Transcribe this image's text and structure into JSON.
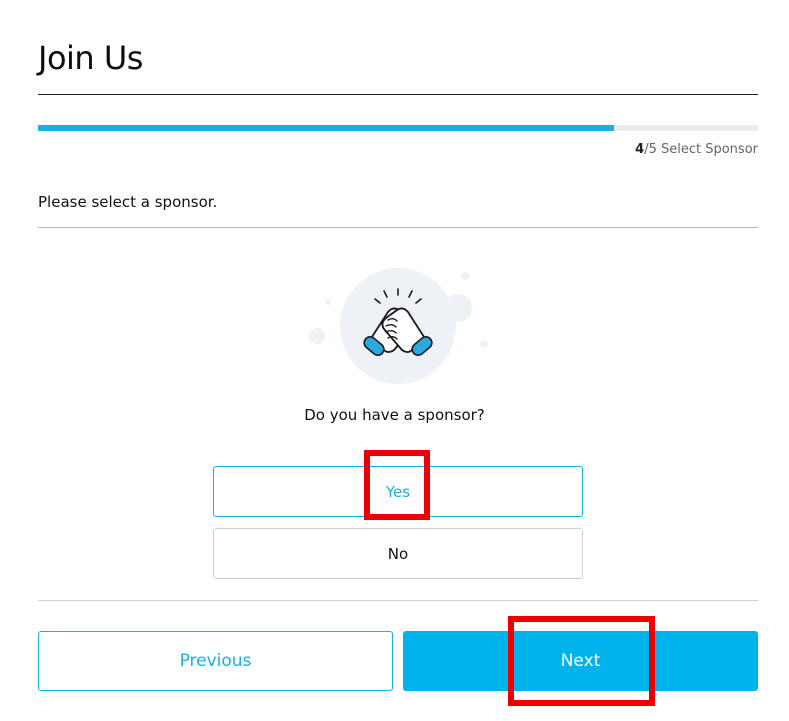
{
  "page": {
    "title": "Join Us"
  },
  "progress": {
    "current_step": "4",
    "total_label": "/5",
    "step_name": "Select Sponsor",
    "fraction": 0.8
  },
  "form": {
    "instruction": "Please select a sponsor.",
    "question": "Do you have a sponsor?",
    "options": [
      {
        "label": "Yes",
        "state": "selected"
      },
      {
        "label": "No",
        "state": "unselected"
      }
    ],
    "illustration_icon": "handshake-icon"
  },
  "navigation": {
    "previous_label": "Previous",
    "next_label": "Next"
  },
  "colors": {
    "accent": "#00b3ec",
    "highlight": "#ee0000"
  }
}
